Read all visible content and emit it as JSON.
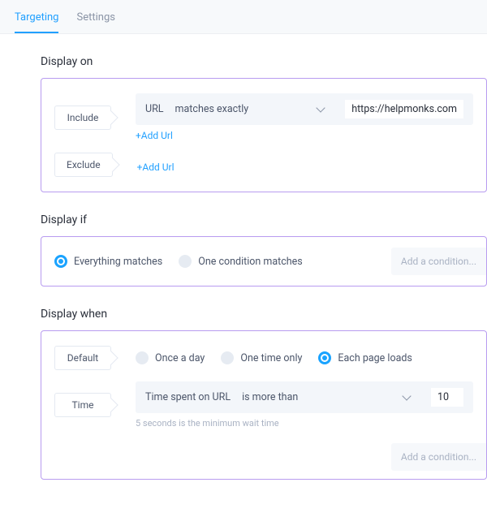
{
  "tabs": {
    "targeting": "Targeting",
    "settings": "Settings",
    "active": "targeting"
  },
  "display_on": {
    "title": "Display on",
    "include_label": "Include",
    "exclude_label": "Exclude",
    "url_rule": {
      "field": "URL",
      "operator": "matches exactly",
      "value": "https://helpmonks.com"
    },
    "add_url": "+Add Url"
  },
  "display_if": {
    "title": "Display if",
    "options": {
      "everything": "Everything matches",
      "one": "One condition matches"
    },
    "selected": "everything",
    "add_condition": "Add a condition..."
  },
  "display_when": {
    "title": "Display when",
    "default_label": "Default",
    "time_label": "Time",
    "frequency": {
      "once_day": "Once a day",
      "one_time": "One time only",
      "each_load": "Each page loads"
    },
    "frequency_selected": "each_load",
    "time_rule": {
      "field": "Time spent on URL",
      "operator": "is more than",
      "value": "10"
    },
    "helper": "5 seconds is the minimum wait time",
    "add_condition": "Add a condition..."
  }
}
